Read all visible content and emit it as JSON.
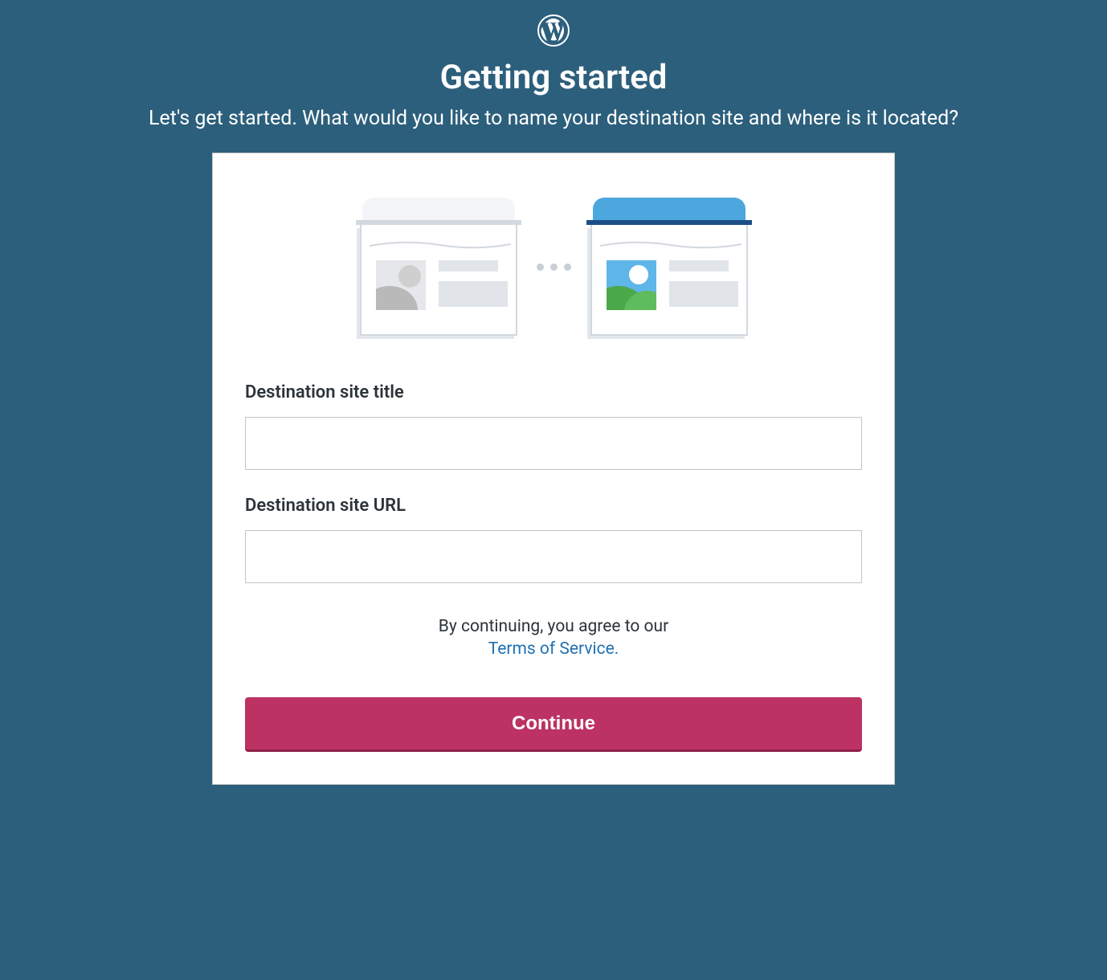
{
  "header": {
    "title": "Getting started",
    "subtitle": "Let's get started. What would you like to name your destination site and where is it located?"
  },
  "form": {
    "site_title": {
      "label": "Destination site title",
      "value": ""
    },
    "site_url": {
      "label": "Destination site URL",
      "value": ""
    }
  },
  "terms": {
    "prefix": "By continuing, you agree to our",
    "link_text": "Terms of Service."
  },
  "actions": {
    "continue_label": "Continue"
  },
  "colors": {
    "background": "#2c5f7c",
    "card_bg": "#ffffff",
    "button_bg": "#bc3263",
    "link": "#2271b1"
  }
}
